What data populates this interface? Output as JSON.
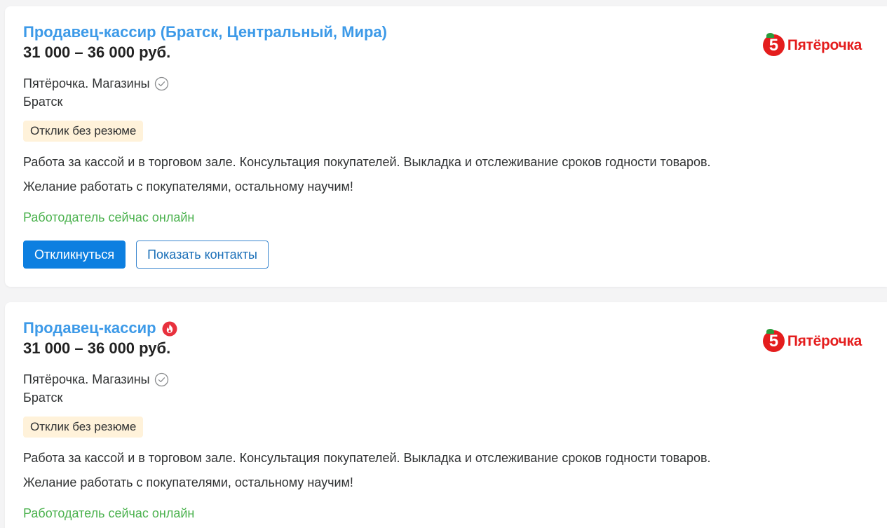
{
  "vacancies": [
    {
      "title": "Продавец-кассир (Братск, Центральный, Мира)",
      "salary": "31 000 – 36 000 руб.",
      "company": "Пятёрочка. Магазины",
      "city": "Братск",
      "badge": "Отклик без резюме",
      "description_1": "Работа за кассой и в торговом зале. Консультация покупателей. Выкладка и отслеживание сроков годности товаров.",
      "description_2": "Желание работать с покупателями, остальному научим!",
      "online_status": "Работодатель сейчас онлайн",
      "respond_label": "Откликнуться",
      "contacts_label": "Показать контакты",
      "logo_digit": "5",
      "logo_text": "Пятёрочка",
      "hot": false
    },
    {
      "title": "Продавец-кассир",
      "salary": "31 000 – 36 000 руб.",
      "company": "Пятёрочка. Магазины",
      "city": "Братск",
      "badge": "Отклик без резюме",
      "description_1": "Работа за кассой и в торговом зале. Консультация покупателей. Выкладка и отслеживание сроков годности товаров.",
      "description_2": "Желание работать с покупателями, остальному научим!",
      "online_status": "Работодатель сейчас онлайн",
      "logo_digit": "5",
      "logo_text": "Пятёрочка",
      "hot": true
    }
  ],
  "colors": {
    "title": "#3d9ae8",
    "online": "#4bb24e",
    "primary_button": "#0d7fe0",
    "badge_bg": "#fff2da",
    "logo_red": "#e41d1d",
    "hot_icon": "#e8313d"
  },
  "icons": {
    "verified": "check-circle-icon",
    "hot": "fire-icon"
  }
}
